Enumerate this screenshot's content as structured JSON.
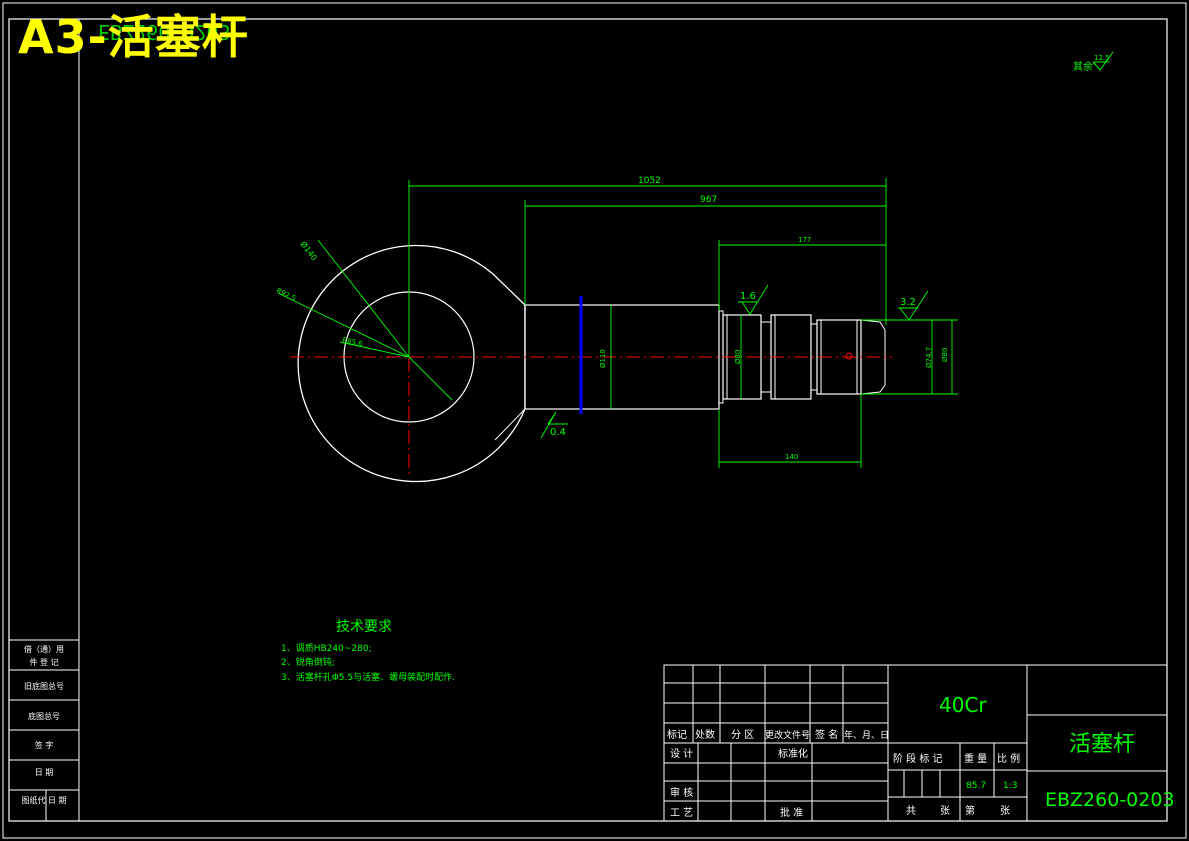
{
  "stamp": {
    "text": "A3-活塞杆",
    "underlay": "EBZ260-0203"
  },
  "colors": {
    "background": "#000000",
    "frame": "#ffffff",
    "dimension": "#00ff00",
    "centerline": "#ff0000",
    "section_mark": "#0000ff",
    "stamp": "#ffff00"
  },
  "roughness_note": {
    "prefix": "其余",
    "value": "12.5"
  },
  "dimensions": {
    "overall_length": "1052",
    "shank_length": "967",
    "thread_zone_length": "177",
    "lower_length": "140",
    "eye_outer_diameter": "Ø140",
    "eye_radius_1": "R92.5",
    "eye_radius_2": "R85.6",
    "shank_diameter": "Ø110",
    "journal_diameter": "Ø80",
    "thread_diameter": "Ø74.7",
    "end_diameter": "Ø80",
    "roughness_1": "1.6",
    "roughness_2": "3.2",
    "roughness_3": "0.4"
  },
  "tech_requirements": {
    "title": "技术要求",
    "items": [
      "1、调质HB240~280;",
      "2、锐角倒钝;",
      "3、活塞杆孔Φ5.5与活塞、螺母装配时配作."
    ]
  },
  "left_column": {
    "rows": [
      "借（通）用",
      "件 登 记",
      "旧底图总号",
      "底图总号",
      "签 字",
      "日 期",
      "图纸代 日 期"
    ]
  },
  "title_block": {
    "material": "40Cr",
    "part_name": "活塞杆",
    "drawing_number": "EBZ260-0203",
    "revision_headers": [
      "标记",
      "处数",
      "分 区",
      "更改文件号",
      "签 名",
      "年、月、日"
    ],
    "design_label": "设 计",
    "standardize_label": "标准化",
    "review_label": "审 核",
    "process_label": "工 艺",
    "approve_label": "批 准",
    "stage_label": "阶 段 标 记",
    "weight_label": "重 量",
    "scale_label": "比 例",
    "weight_value": "85.7",
    "scale_value": "1:3",
    "total_label": "共",
    "sheets_label": "张",
    "sheet_label": "第",
    "sheet_suffix": "张"
  }
}
